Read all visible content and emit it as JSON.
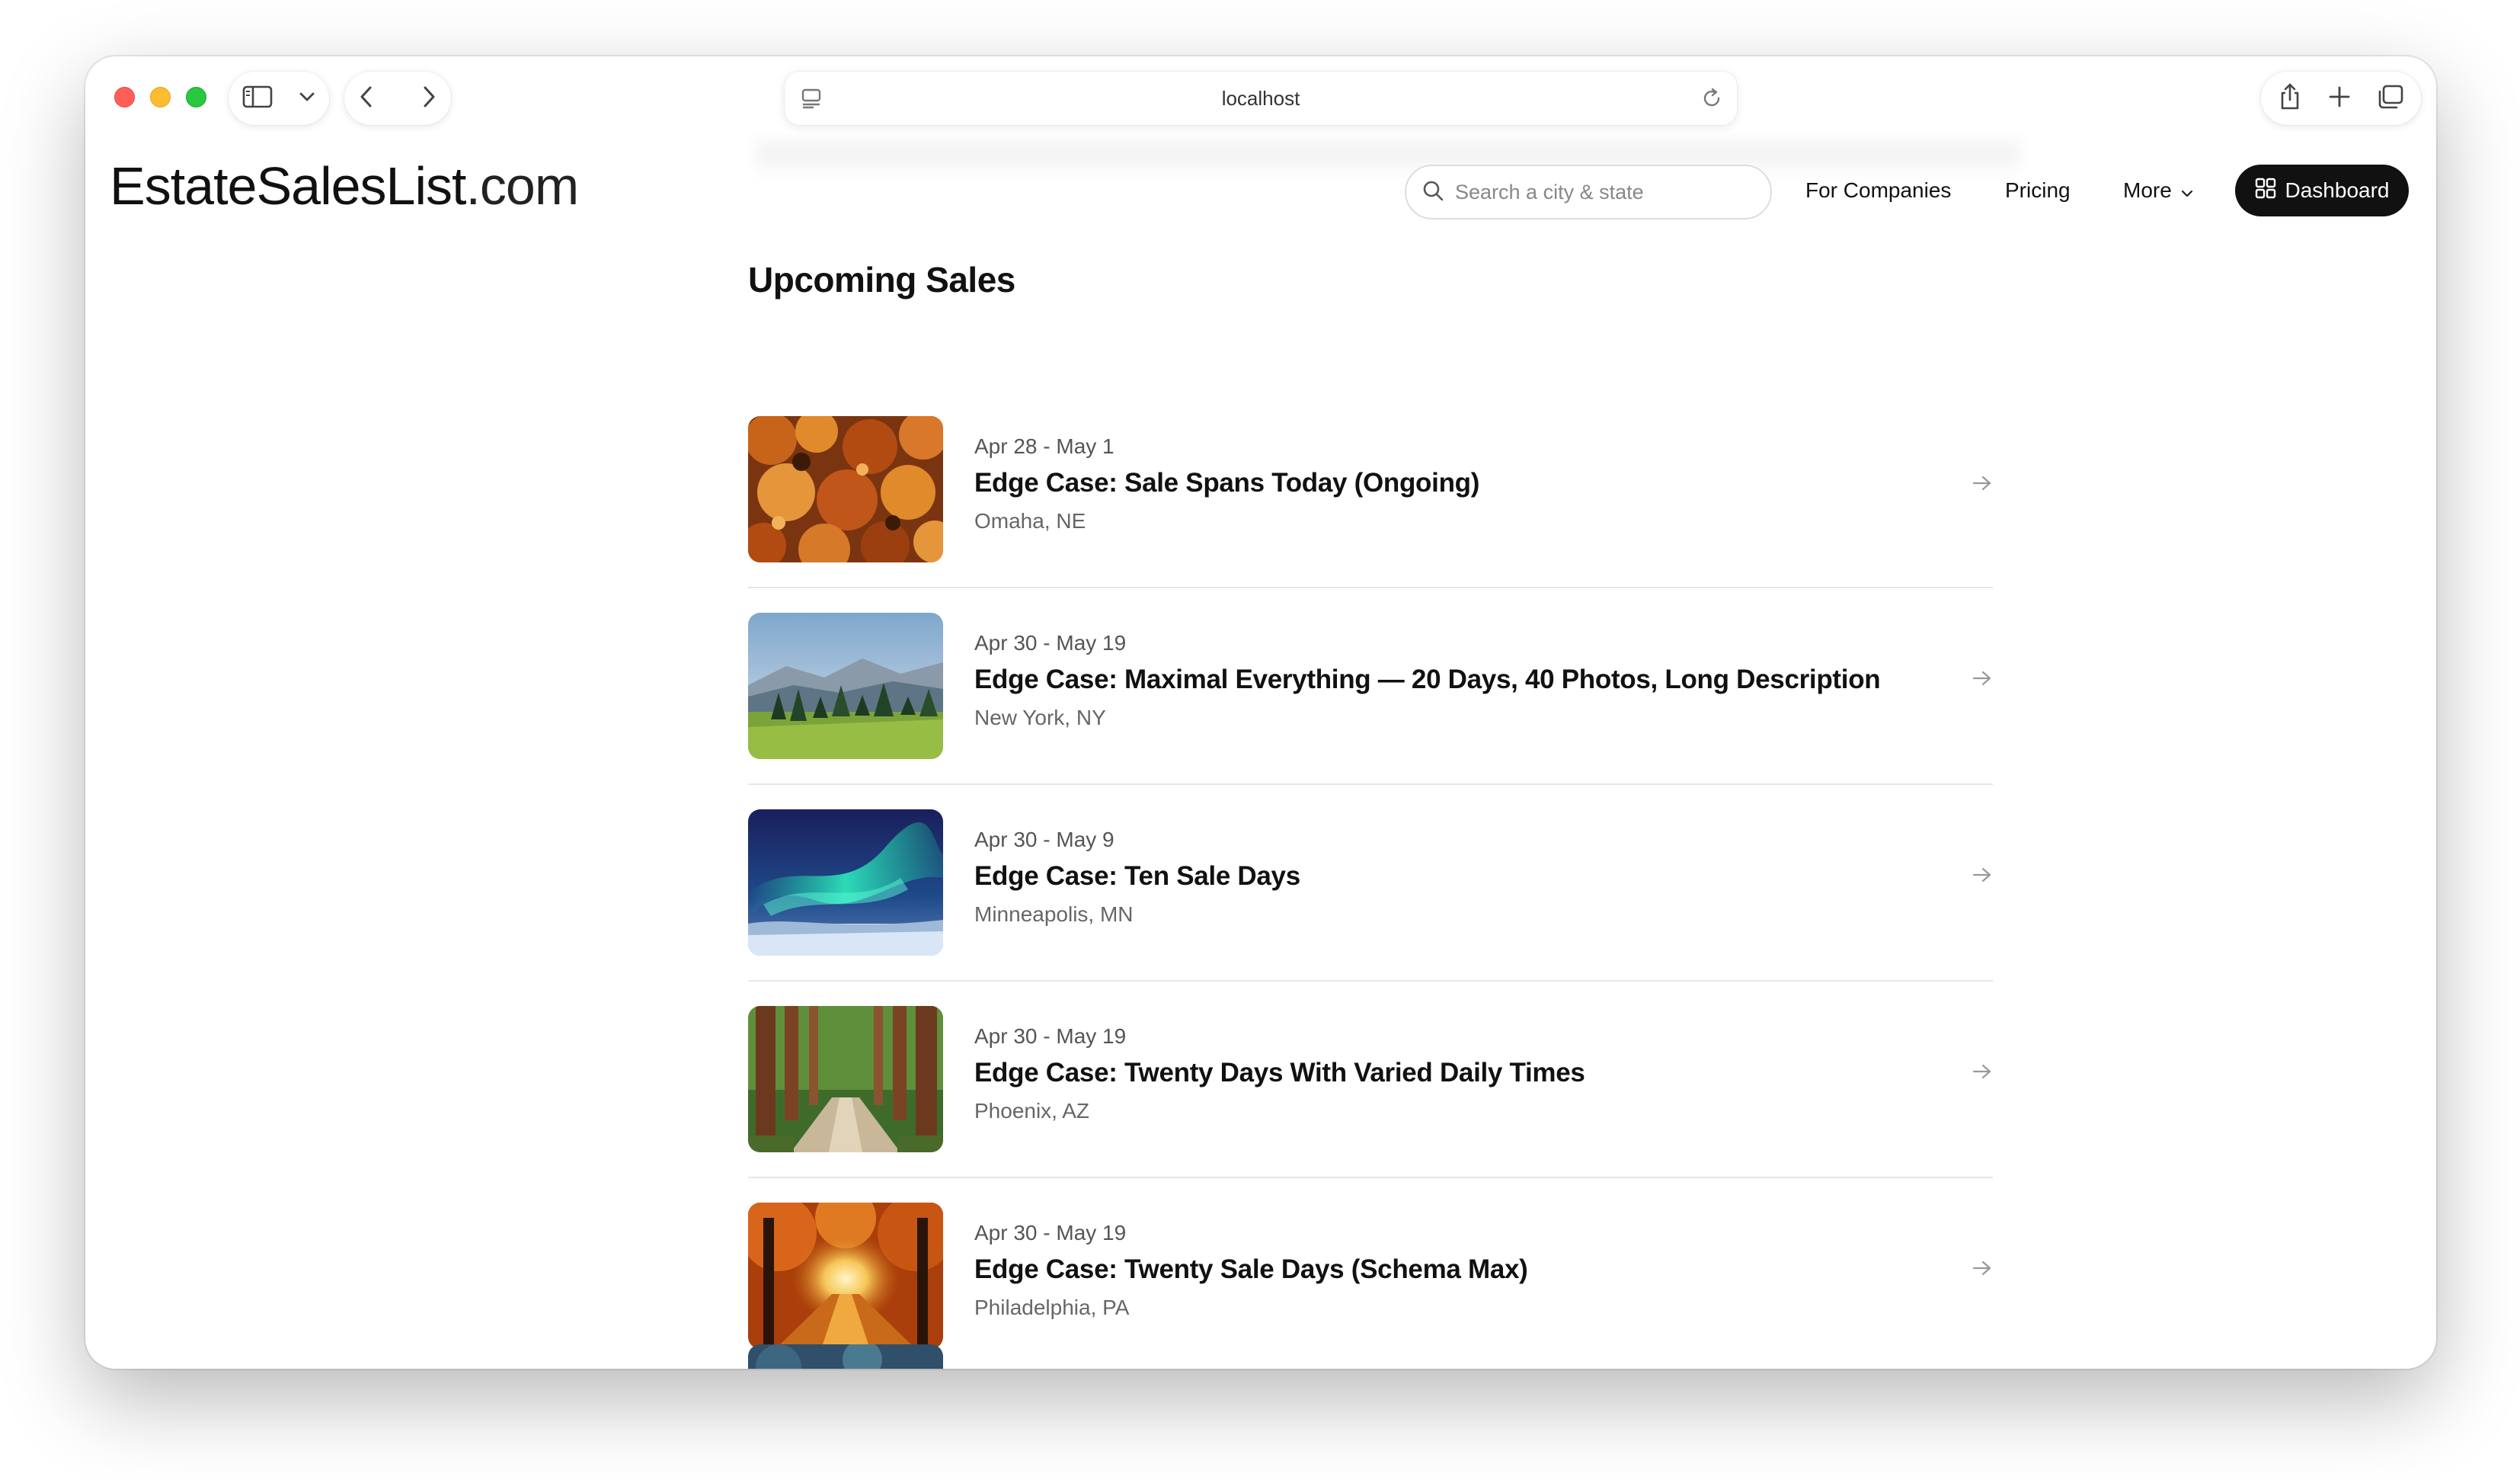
{
  "browser": {
    "url": "localhost"
  },
  "site": {
    "logo_main": "EstateSalesList",
    "logo_tld": ".com"
  },
  "header": {
    "search_placeholder": "Search a city & state",
    "nav": {
      "companies": "For Companies",
      "pricing": "Pricing",
      "more": "More"
    },
    "dashboard_label": "Dashboard"
  },
  "main": {
    "title": "Upcoming Sales",
    "sales": [
      {
        "dates": "Apr 28 - May 1",
        "title": "Edge Case: Sale Spans Today (Ongoing)",
        "location": "Omaha, NE",
        "image": "autumn-leaves"
      },
      {
        "dates": "Apr 30 - May 19",
        "title": "Edge Case: Maximal Everything — 20 Days, 40 Photos, Long Description",
        "location": "New York, NY",
        "image": "mountain-forest"
      },
      {
        "dates": "Apr 30 - May 9",
        "title": "Edge Case: Ten Sale Days",
        "location": "Minneapolis, MN",
        "image": "aurora"
      },
      {
        "dates": "Apr 30 - May 19",
        "title": "Edge Case: Twenty Days With Varied Daily Times",
        "location": "Phoenix, AZ",
        "image": "redwood-path"
      },
      {
        "dates": "Apr 30 - May 19",
        "title": "Edge Case: Twenty Sale Days (Schema Max)",
        "location": "Philadelphia, PA",
        "image": "autumn-tunnel"
      }
    ]
  },
  "colors": {
    "accent_dark": "#111111",
    "divider": "#e6e6e6",
    "muted_text": "#666666"
  }
}
